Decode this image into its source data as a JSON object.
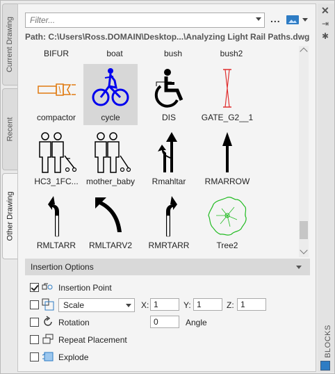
{
  "vtabs": {
    "current": "Current Drawing",
    "recent": "Recent",
    "other": "Other Drawing"
  },
  "toolbar": {
    "filter_placeholder": "Filter...",
    "ellipsis": "..."
  },
  "path_label": "Path: C:\\Users\\Ross.DOMAIN\\Desktop...\\Analyzing Light Rail Paths.dwg",
  "top_row_labels": [
    "BIFUR",
    "boat",
    "bush",
    "bush2"
  ],
  "blocks": [
    {
      "label": "compactor",
      "icon": "compactor-icon",
      "color": "#e07a10",
      "selected": false
    },
    {
      "label": "cycle",
      "icon": "cycle-icon",
      "color": "#0000ee",
      "selected": true
    },
    {
      "label": "DIS",
      "icon": "wheelchair-icon",
      "color": "#000000",
      "selected": false
    },
    {
      "label": "GATE_G2__1",
      "icon": "gate-icon",
      "color": "#e03030",
      "selected": false
    },
    {
      "label": "HC3_1FC...",
      "icon": "people-icon",
      "color": "#000000",
      "selected": false
    },
    {
      "label": "mother_baby",
      "icon": "mother-baby-icon",
      "color": "#000000",
      "selected": false
    },
    {
      "label": "Rmahltar",
      "icon": "left-turn-arrow-icon",
      "color": "#000000",
      "selected": false
    },
    {
      "label": "RMARROW",
      "icon": "up-arrow-icon",
      "color": "#000000",
      "selected": false
    },
    {
      "label": "RMLTARR",
      "icon": "left-turn-icon",
      "color": "#000000",
      "selected": false
    },
    {
      "label": "RMLTARV2",
      "icon": "left-curve-arrow-icon",
      "color": "#000000",
      "selected": false
    },
    {
      "label": "RMRTARR",
      "icon": "right-turn-icon",
      "color": "#000000",
      "selected": false
    },
    {
      "label": "Tree2",
      "icon": "tree-icon",
      "color": "#22bb22",
      "selected": false
    }
  ],
  "insertion": {
    "header": "Insertion Options",
    "insertion_point": {
      "label": "Insertion Point",
      "checked": true
    },
    "scale": {
      "checked": false,
      "mode": "Scale",
      "x_label": "X:",
      "x": "1",
      "y_label": "Y:",
      "y": "1",
      "z_label": "Z:",
      "z": "1"
    },
    "rotation": {
      "label": "Rotation",
      "checked": false,
      "value": "0",
      "angle_label": "Angle"
    },
    "repeat": {
      "label": "Repeat Placement",
      "checked": false
    },
    "explode": {
      "label": "Explode",
      "checked": false
    }
  },
  "strip": {
    "title": "BLOCKS"
  }
}
